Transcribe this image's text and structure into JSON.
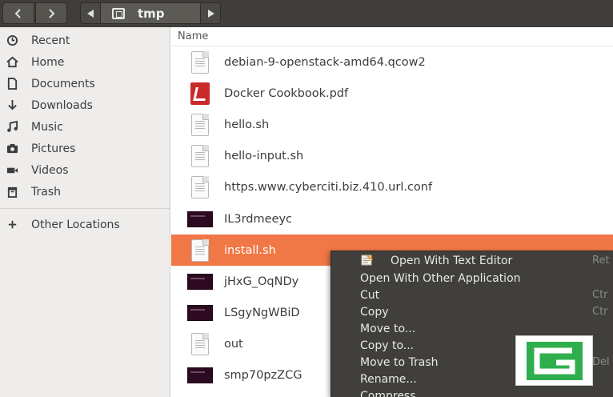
{
  "header": {
    "back_icon": "chevron-left-icon",
    "forward_icon": "chevron-right-icon",
    "path_left_icon": "triangle-left-icon",
    "path_right_icon": "triangle-right-icon",
    "current_folder": "tmp",
    "folder_icon": "folder-icon"
  },
  "sidebar": {
    "items": [
      {
        "label": "Recent",
        "icon": "clock-icon"
      },
      {
        "label": "Home",
        "icon": "home-icon"
      },
      {
        "label": "Documents",
        "icon": "document-icon"
      },
      {
        "label": "Downloads",
        "icon": "download-arrow-icon"
      },
      {
        "label": "Music",
        "icon": "music-note-icon"
      },
      {
        "label": "Pictures",
        "icon": "camera-icon"
      },
      {
        "label": "Videos",
        "icon": "video-icon"
      },
      {
        "label": "Trash",
        "icon": "trash-icon"
      }
    ],
    "other": {
      "label": "Other Locations",
      "icon": "plus-icon"
    }
  },
  "list": {
    "column_header": "Name",
    "files": [
      {
        "name": "debian-9-openstack-amd64.qcow2",
        "icon": "generic-file-icon"
      },
      {
        "name": "Docker Cookbook.pdf",
        "icon": "pdf-file-icon"
      },
      {
        "name": "hello.sh",
        "icon": "text-file-icon"
      },
      {
        "name": "hello-input.sh",
        "icon": "text-file-icon"
      },
      {
        "name": "https.www.cyberciti.biz.410.url.conf",
        "icon": "text-file-icon"
      },
      {
        "name": "IL3rdmeeyc",
        "icon": "folder-thumbnail-icon"
      },
      {
        "name": "install.sh",
        "icon": "text-file-icon",
        "selected": true
      },
      {
        "name": "jHxG_OqNDy",
        "icon": "folder-thumbnail-icon"
      },
      {
        "name": "LSgyNgWBiD",
        "icon": "folder-thumbnail-icon"
      },
      {
        "name": "out",
        "icon": "text-file-icon"
      },
      {
        "name": "smp70pzZCG",
        "icon": "folder-thumbnail-icon"
      }
    ]
  },
  "context_menu": {
    "items": [
      {
        "label": "Open With Text Editor",
        "shortcut": "Ret",
        "icon": "text-editor-icon"
      },
      {
        "label": "Open With Other Application",
        "shortcut": ""
      },
      {
        "label": "Cut",
        "shortcut": "Ctr"
      },
      {
        "label": "Copy",
        "shortcut": "Ctr"
      },
      {
        "label": "Move to...",
        "shortcut": ""
      },
      {
        "label": "Copy to...",
        "shortcut": ""
      },
      {
        "label": "Move to Trash",
        "shortcut": "Del"
      },
      {
        "label": "Rename...",
        "shortcut": ""
      },
      {
        "label": "Compress...",
        "shortcut": ""
      }
    ]
  },
  "watermark": {
    "icon": "g-logo-icon"
  },
  "colors": {
    "selection": "#f07746",
    "header_bg": "#3f3e3a",
    "menu_bg": "#403f3b",
    "sidebar_bg": "#eeedec",
    "logo_green": "#2fae4e"
  }
}
